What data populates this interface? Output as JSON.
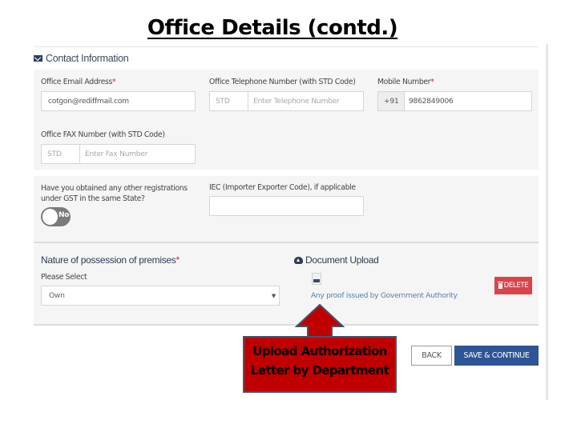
{
  "slide": {
    "title": "Office Details (contd.)"
  },
  "contact_section": {
    "icon": "envelope-icon",
    "title": "Contact Information",
    "email": {
      "label": "Office Email Address",
      "required": true,
      "value": "cotgon@rediffmail.com"
    },
    "telephone": {
      "label": "Office Telephone Number (with STD Code)",
      "std_placeholder": "STD",
      "number_placeholder": "Enter Telephone Number"
    },
    "mobile": {
      "label": "Mobile Number",
      "required": true,
      "prefix": "+91",
      "value": "9862849006"
    },
    "fax": {
      "label": "Office FAX Number (with STD Code)",
      "std_placeholder": "STD",
      "number_placeholder": "Enter Fax Number"
    }
  },
  "registrations": {
    "question_line1": "Have you obtained any other registrations",
    "question_line2": "under GST in the same State?",
    "toggle_label": "No",
    "toggle_on": false,
    "iec_label": "IEC (Importer Exporter Code), if applicable",
    "iec_value": ""
  },
  "premises": {
    "title": "Nature of possession of premises",
    "required": true,
    "select_label": "Please Select",
    "selected": "Own",
    "caret": "▼"
  },
  "document_upload": {
    "icon": "cloud-upload-icon",
    "title": "Document Upload",
    "file_icon": "file-icon",
    "file_link": "Any proof issued by Government Authority",
    "delete_label": "DELETE"
  },
  "actions": {
    "back_label": "BACK",
    "save_label": "SAVE & CONTINUE"
  },
  "callout": {
    "line1": "Upload Authorization",
    "line2": "Letter by Department"
  },
  "colors": {
    "primary": "#2f5496",
    "danger": "#d9444a",
    "callout_fill": "#c00000",
    "callout_border": "#44546a",
    "required": "#c9252c"
  }
}
